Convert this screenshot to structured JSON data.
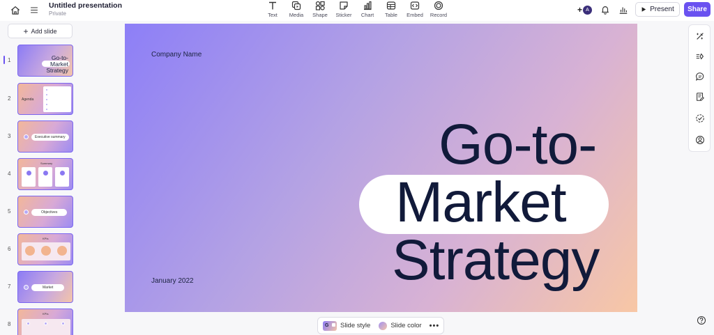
{
  "app": {
    "title": "Untitled presentation",
    "subtitle": "Private"
  },
  "toolbar": {
    "tools": [
      {
        "label": "Text",
        "icon": "text-icon"
      },
      {
        "label": "Media",
        "icon": "media-icon"
      },
      {
        "label": "Shape",
        "icon": "shape-icon"
      },
      {
        "label": "Sticker",
        "icon": "sticker-icon"
      },
      {
        "label": "Chart",
        "icon": "chart-icon"
      },
      {
        "label": "Table",
        "icon": "table-icon"
      },
      {
        "label": "Embed",
        "icon": "embed-icon"
      },
      {
        "label": "Record",
        "icon": "record-icon"
      }
    ],
    "collab_plus": "+",
    "avatar_initial": "A",
    "present_label": "Present",
    "share_label": "Share"
  },
  "sidebar": {
    "add_slide_label": "Add slide",
    "slides": [
      {
        "number": "1",
        "active": true,
        "thumb_title": [
          "Go-to-",
          "Market",
          "Strategy"
        ]
      },
      {
        "number": "2",
        "thumb_title": "Agenda"
      },
      {
        "number": "3",
        "thumb_title": "Executive summary"
      },
      {
        "number": "4",
        "thumb_title": "Summary"
      },
      {
        "number": "5",
        "thumb_title": "Objectives"
      },
      {
        "number": "6",
        "thumb_title": "KPIs"
      },
      {
        "number": "7",
        "thumb_title": "Market"
      },
      {
        "number": "8",
        "thumb_title": "KPIs"
      }
    ]
  },
  "slide": {
    "company": "Company Name",
    "title_lines": [
      "Go-to-",
      "Market",
      "Strategy"
    ],
    "date": "January 2022",
    "colors": {
      "gradient_start": "#8d7ff7",
      "gradient_end": "#f8c7a5",
      "title": "#111a3a"
    }
  },
  "bottom_bar": {
    "slide_style_label": "Slide style",
    "slide_style_icon_letter": "G",
    "slide_color_label": "Slide color",
    "more_label": "•••"
  },
  "right_panel": {
    "icons": [
      "magic-tools-icon",
      "animation-icon",
      "comment-icon",
      "notes-icon",
      "checklist-icon",
      "user-circle-icon"
    ]
  },
  "help_icon": "help-icon",
  "accent_color": "#6a52f0"
}
